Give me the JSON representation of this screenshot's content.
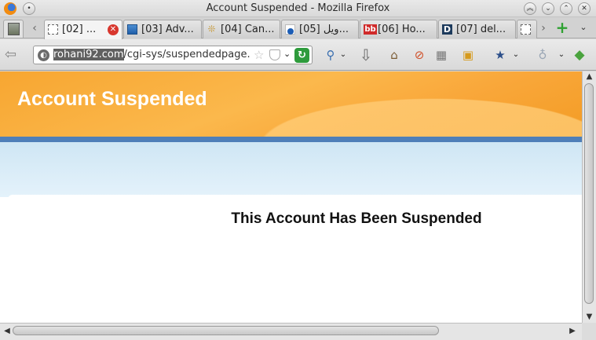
{
  "window": {
    "title": "Account Suspended - Mozilla Firefox"
  },
  "tabs": [
    {
      "label": "[02] ...",
      "active": true,
      "favicon": "blank-page-icon"
    },
    {
      "label": "[03] Adv...",
      "favicon": "blue-site-icon"
    },
    {
      "label": "[04] Can...",
      "favicon": "ornament-icon"
    },
    {
      "label": "[05] ويل...",
      "favicon": "blue-dot-icon"
    },
    {
      "label": "[06] Ho...",
      "favicon": "bb-icon",
      "favicon_text": "bb"
    },
    {
      "label": "[07] del...",
      "favicon": "d-icon",
      "favicon_text": "D"
    }
  ],
  "navbar": {
    "url_host": "rohani92.com",
    "url_path": "/cgi-sys/suspendedpage."
  },
  "page": {
    "banner_title": "Account Suspended",
    "message": "This Account Has Been Suspended"
  },
  "colors": {
    "banner_orange": "#f7a631",
    "stripe_blue": "#4f7fb8",
    "reload_green": "#2e9b3c",
    "tab_close_red": "#d8372e"
  }
}
